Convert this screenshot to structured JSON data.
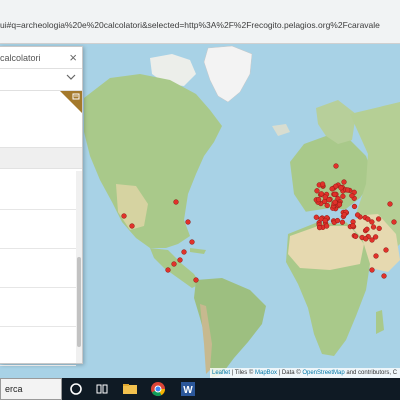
{
  "browser": {
    "url": "ui#q=archeologia%20e%20calcolatori&selected=http%3A%2F%2Frecogito.pelagios.org%2Fcaravale"
  },
  "search": {
    "query": "calcolatori",
    "close_icon": "close-icon"
  },
  "filter": {
    "icon": "chevron-down-icon"
  },
  "result_card": {
    "corner_icon": "bookmark-icon",
    "accent": "#a4792b"
  },
  "map": {
    "marker_color": "#e0312a",
    "ocean_color": "#a8d2e6",
    "land_color": "#a9c98a",
    "desert_color": "#e6d9b0",
    "ice_color": "#f3f3f3"
  },
  "attribution": {
    "leaflet": "Leaflet",
    "sep1": " | Tiles © ",
    "mapbox": "MapBox",
    "sep2": " | Data © ",
    "osm": "OpenStreetMap",
    "rest": " and contributors, C"
  },
  "taskbar": {
    "search_text": "erca",
    "icons": [
      "cortana-icon",
      "task-view-icon",
      "file-explorer-icon",
      "chrome-icon",
      "word-icon"
    ]
  }
}
